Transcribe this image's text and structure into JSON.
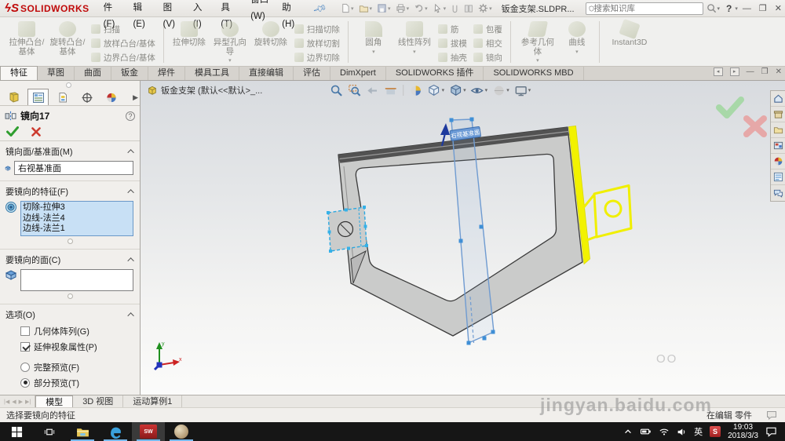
{
  "titlebar": {
    "logo_text": "SOLIDWORKS",
    "menus": [
      "文件(F)",
      "编辑(E)",
      "视图(V)",
      "插入(I)",
      "工具(T)",
      "窗口(W)",
      "帮助(H)"
    ],
    "doc_title": "钣金支架.SLDPR...",
    "search_placeholder": "搜索知识库",
    "help_label": "?",
    "minimize": "—",
    "restore": "❐",
    "close": "✕"
  },
  "command_tabs": {
    "items": [
      "特征",
      "草图",
      "曲面",
      "钣金",
      "焊件",
      "模具工具",
      "直接编辑",
      "评估",
      "DimXpert",
      "SOLIDWORKS 插件",
      "SOLIDWORKS MBD"
    ],
    "active": "特征"
  },
  "ribbon": {
    "groups": [
      {
        "big": [
          "拉伸凸台/基体",
          "旋转凸台/基体"
        ],
        "stack": [
          "扫描",
          "放样凸台/基体",
          "边界凸台/基体"
        ]
      },
      {
        "big": [
          "拉伸切除",
          "异型孔向导",
          "旋转切除"
        ],
        "stack": [
          "扫描切除",
          "放样切割",
          "边界切除"
        ]
      },
      {
        "big": [
          "圆角",
          "线性阵列"
        ],
        "stack": [
          "筋",
          "拔模",
          "抽壳"
        ],
        "stack2": [
          "包覆",
          "相交",
          "镜向"
        ]
      },
      {
        "big": [
          "参考几何体",
          "曲线"
        ]
      },
      {
        "big": [
          "Instant3D"
        ]
      }
    ]
  },
  "pm": {
    "title": "镜向17",
    "mirror_face": {
      "header": "镜向面/基准面(M)",
      "value": "右视基准面"
    },
    "features": {
      "header": "要镜向的特征(F)",
      "items": [
        "切除-拉伸3",
        "边线-法兰4",
        "边线-法兰1"
      ]
    },
    "faces": {
      "header": "要镜向的面(C)"
    },
    "options": {
      "header": "选项(O)",
      "cb1": {
        "label": "几何体阵列(G)",
        "checked": false
      },
      "cb2": {
        "label": "延伸视象属性(P)",
        "checked": true
      },
      "r1": {
        "label": "完整预览(F)",
        "checked": false
      },
      "r2": {
        "label": "部分预览(T)",
        "checked": true
      }
    }
  },
  "viewport": {
    "doc_tab": "钣金支架 (默认<<默认>_...",
    "plane_label": "右视基准面",
    "stray_text": "OO",
    "watermark": "jingyan.baidu.com"
  },
  "bottom_tabs": {
    "items": [
      "模型",
      "3D 视图",
      "运动算例1"
    ],
    "active": "模型"
  },
  "statusbar": {
    "message": "选择要镜向的特征",
    "mode": "在编辑 零件"
  },
  "taskbar": {
    "ime": "英",
    "time": "19:03",
    "date": "2018/3/3"
  }
}
